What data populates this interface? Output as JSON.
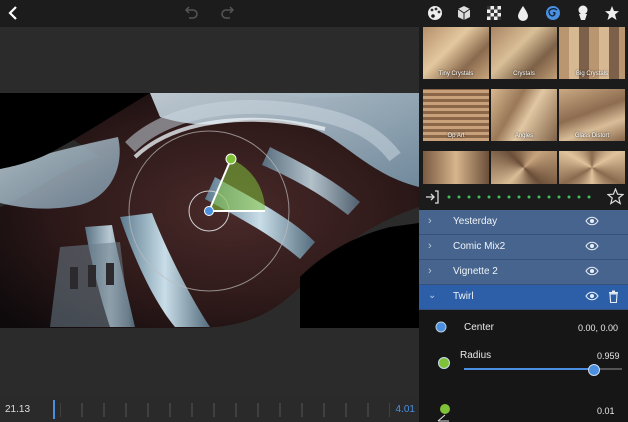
{
  "toolbar": {
    "icons": [
      "back-icon",
      "undo-icon",
      "redo-icon",
      "palette-icon",
      "cube-icon",
      "checker-icon",
      "drop-icon",
      "twirl-icon",
      "mask-icon",
      "star-icon"
    ],
    "active_color": "#4a8fe0"
  },
  "effects_grid": {
    "items": [
      {
        "label": "Tiny Crystals"
      },
      {
        "label": "Crystals"
      },
      {
        "label": "Big Crystals"
      },
      {
        "label": "Op Art"
      },
      {
        "label": "Angles"
      },
      {
        "label": "Glass Distort"
      },
      {
        "label": ""
      },
      {
        "label": ""
      },
      {
        "label": ""
      }
    ]
  },
  "layers": [
    {
      "name": "Yesterday",
      "selected": false
    },
    {
      "name": "Comic Mix2",
      "selected": false
    },
    {
      "name": "Vignette 2",
      "selected": false
    },
    {
      "name": "Twirl",
      "selected": true
    }
  ],
  "properties": {
    "center_label": "Center",
    "center_value": "0.00, 0.00",
    "radius_label": "Radius",
    "radius_value": "0.959",
    "radius_fraction": 0.82,
    "third_value": "0.01"
  },
  "timeline": {
    "start": "21.13",
    "end": "4.01"
  }
}
